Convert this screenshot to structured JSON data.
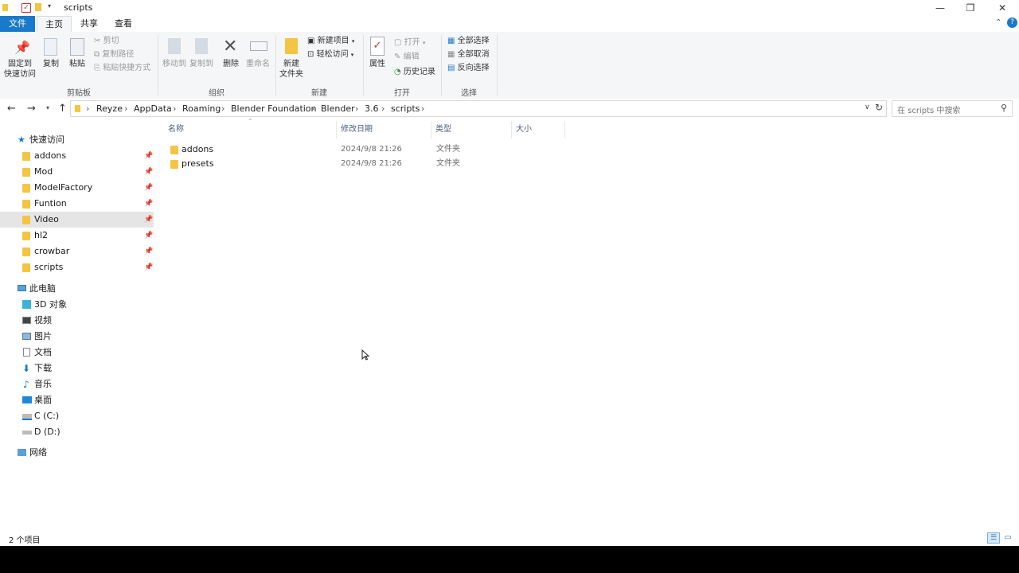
{
  "window": {
    "title": "scripts"
  },
  "tabs": [
    {
      "label": "文件"
    },
    {
      "label": "主页"
    },
    {
      "label": "共享"
    },
    {
      "label": "查看"
    }
  ],
  "ribbon": {
    "clipboard": {
      "pin_label_1": "固定到",
      "pin_label_2": "快速访问",
      "copy": "复制",
      "paste": "粘贴",
      "cut": "剪切",
      "copy_path": "复制路径",
      "paste_shortcut": "粘贴快捷方式",
      "group": "剪贴板"
    },
    "organize": {
      "move_to": "移动到",
      "copy_to": "复制到",
      "delete": "删除",
      "rename": "重命名",
      "group": "组织"
    },
    "new": {
      "new_item": "新建项目",
      "easy_access": "轻松访问",
      "new_folder_1": "新建",
      "new_folder_2": "文件夹",
      "group": "新建"
    },
    "open": {
      "properties": "属性",
      "open": "打开",
      "edit": "编辑",
      "history": "历史记录",
      "group": "打开"
    },
    "select": {
      "select_all": "全部选择",
      "select_none": "全部取消",
      "invert": "反向选择",
      "group": "选择"
    }
  },
  "address": {
    "crumbs": [
      "Reyze",
      "AppData",
      "Roaming",
      "Blender Foundation",
      "Blender",
      "3.6",
      "scripts"
    ],
    "search_placeholder": "在 scripts 中搜索"
  },
  "nav": {
    "quick_access": "快速访问",
    "pinned": [
      "addons",
      "Mod",
      "ModelFactory",
      "Funtion",
      "Video",
      "hl2",
      "crowbar",
      "scripts"
    ],
    "selected": "Video",
    "this_pc": "此电脑",
    "pc_items": [
      "3D 对象",
      "视频",
      "图片",
      "文档",
      "下载",
      "音乐",
      "桌面",
      "C (C:)",
      "D (D:)"
    ],
    "network": "网络"
  },
  "columns": {
    "name": "名称",
    "modified": "修改日期",
    "type": "类型",
    "size": "大小"
  },
  "files": [
    {
      "name": "addons",
      "modified": "2024/9/8 21:26",
      "type": "文件夹"
    },
    {
      "name": "presets",
      "modified": "2024/9/8 21:26",
      "type": "文件夹"
    }
  ],
  "status": {
    "count": "2 个项目"
  },
  "colors": {
    "folder": "#f4c542",
    "accent": "#1979ca",
    "selected_bg": "#e5e5e5"
  }
}
